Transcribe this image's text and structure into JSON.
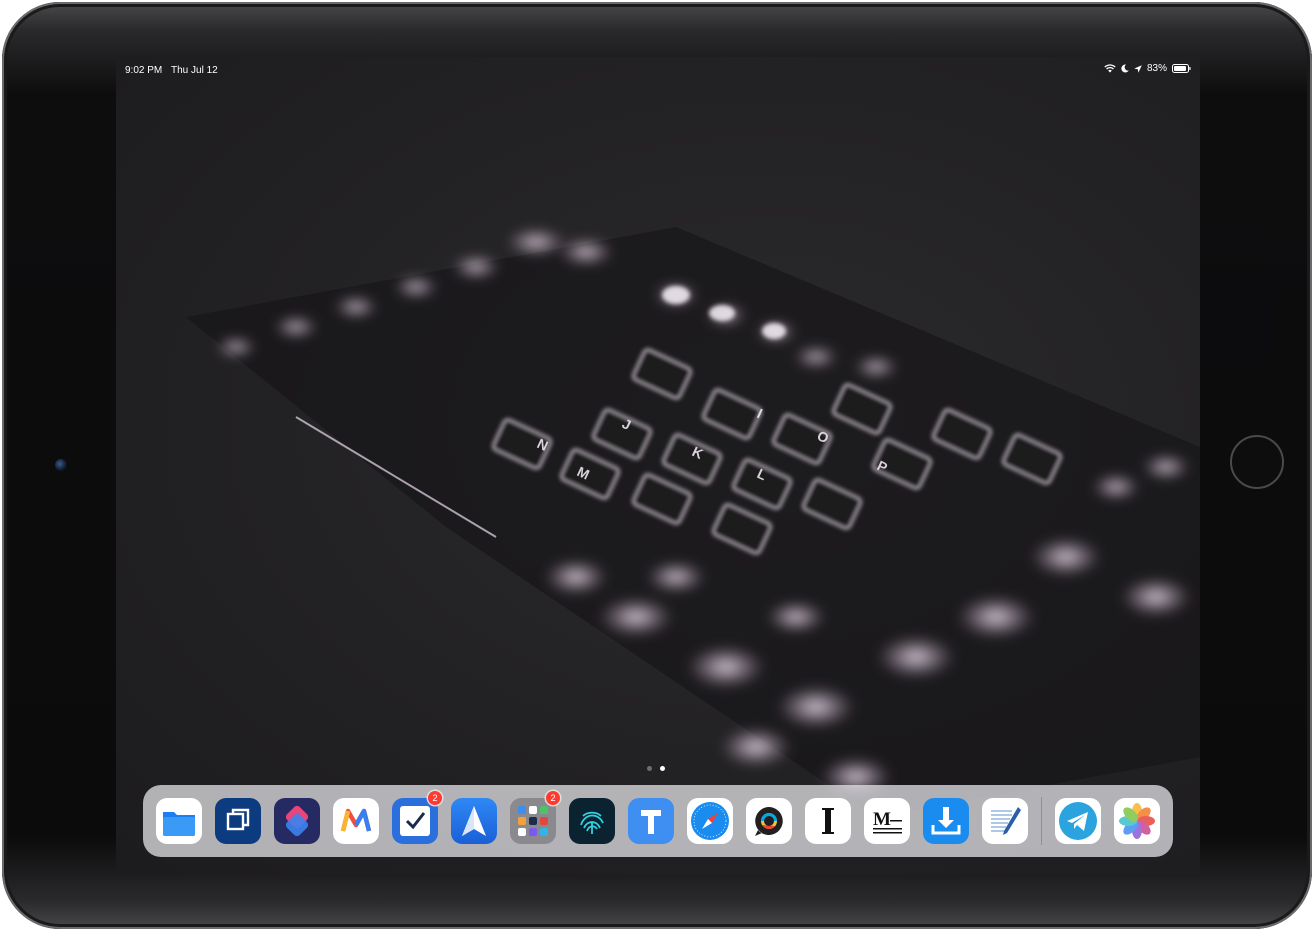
{
  "status_bar": {
    "time": "9:02 PM",
    "date": "Thu Jul 12",
    "battery": "83%",
    "icons": [
      "wifi-icon",
      "moon-icon",
      "location-icon",
      "battery-icon"
    ]
  },
  "home_screen": {
    "page_count": 2,
    "active_page": 2
  },
  "dock": {
    "apps": [
      {
        "name": "Files",
        "icon": "files-icon",
        "color": "#1e88f5"
      },
      {
        "name": "Copied",
        "icon": "copied-icon",
        "color": "#0f3e86"
      },
      {
        "name": "Shortcuts",
        "icon": "shortcuts-icon",
        "color": "#2b2f6f"
      },
      {
        "name": "Spark",
        "icon": "m-icon",
        "color": "#ffffff"
      },
      {
        "name": "Things",
        "icon": "checkbox-icon",
        "color": "#2a6fdc",
        "badge": "2"
      },
      {
        "name": "Spark",
        "icon": "send-arrow-icon",
        "color": "#1e6fe0"
      },
      {
        "name": "Folder",
        "icon": "folder-icon",
        "color": "#8a8a8e",
        "badge": "2"
      },
      {
        "name": "1Password",
        "icon": "fingerprint-icon",
        "color": "#0b2230"
      },
      {
        "name": "Typeeto",
        "icon": "t-icon",
        "color": "#3f8ef2"
      },
      {
        "name": "Safari",
        "icon": "safari-icon",
        "color": "#1a8cf0"
      },
      {
        "name": "Discourse",
        "icon": "chat-bubble-icon",
        "color": "#ffffff"
      },
      {
        "name": "Instapaper",
        "icon": "i-icon",
        "color": "#ffffff"
      },
      {
        "name": "Medium",
        "icon": "medium-icon",
        "color": "#ffffff"
      },
      {
        "name": "Transloader",
        "icon": "download-icon",
        "color": "#1a8cf0"
      },
      {
        "name": "Editorial",
        "icon": "document-pen-icon",
        "color": "#ffffff"
      },
      {
        "name": "Telegram",
        "icon": "telegram-icon",
        "color": "#2aa3df"
      },
      {
        "name": "Photos",
        "icon": "photos-icon",
        "color": "#ffffff"
      }
    ]
  }
}
